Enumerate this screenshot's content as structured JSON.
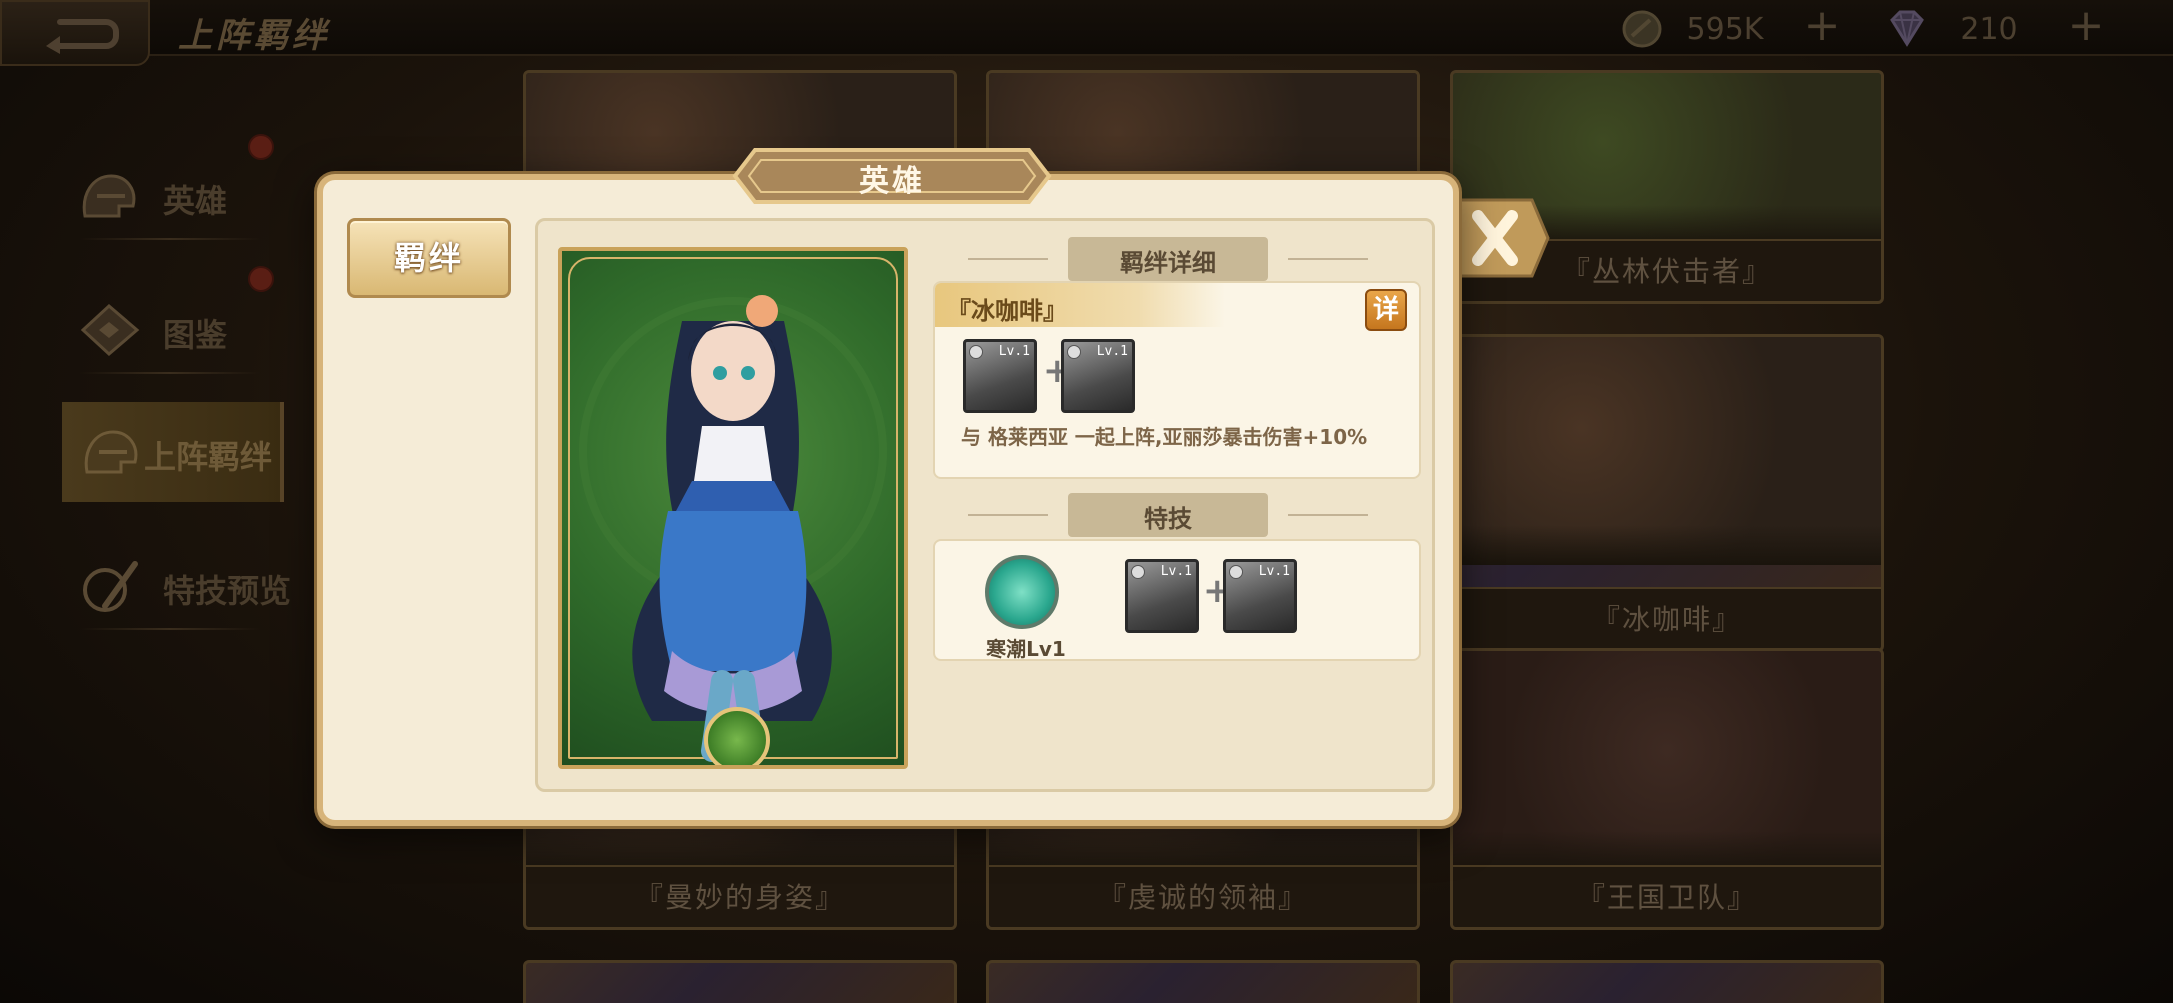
{
  "topbar": {
    "title": "上阵羁绊",
    "coins": "595K",
    "gems": "210"
  },
  "sidebar": {
    "items": [
      {
        "label": "英雄"
      },
      {
        "label": "图鉴"
      },
      {
        "label": "上阵羁绊"
      },
      {
        "label": "特技预览"
      }
    ]
  },
  "bg_cards": [
    "『丛林伏击者』",
    "『冰咖啡』",
    "『曼妙的身姿』",
    "『虔诚的领袖』",
    "『王国卫队』"
  ],
  "modal": {
    "tab_title": "英雄",
    "side_tab": "羁绊",
    "bond_section_title": "羁绊详细",
    "bond_name": "『冰咖啡』",
    "detail_button": "详",
    "level_tag": "Lv.1",
    "bond_description": "与 格莱西亚 一起上阵,亚丽莎暴击伤害+10%",
    "skill_section_title": "特技",
    "skill_name": "寒潮Lv1"
  },
  "colors": {
    "modal_bg": "#f5ecd7",
    "modal_border": "#d7b47a",
    "tab_brown": "#a9875a",
    "detail_orange": "#d98a2c"
  }
}
